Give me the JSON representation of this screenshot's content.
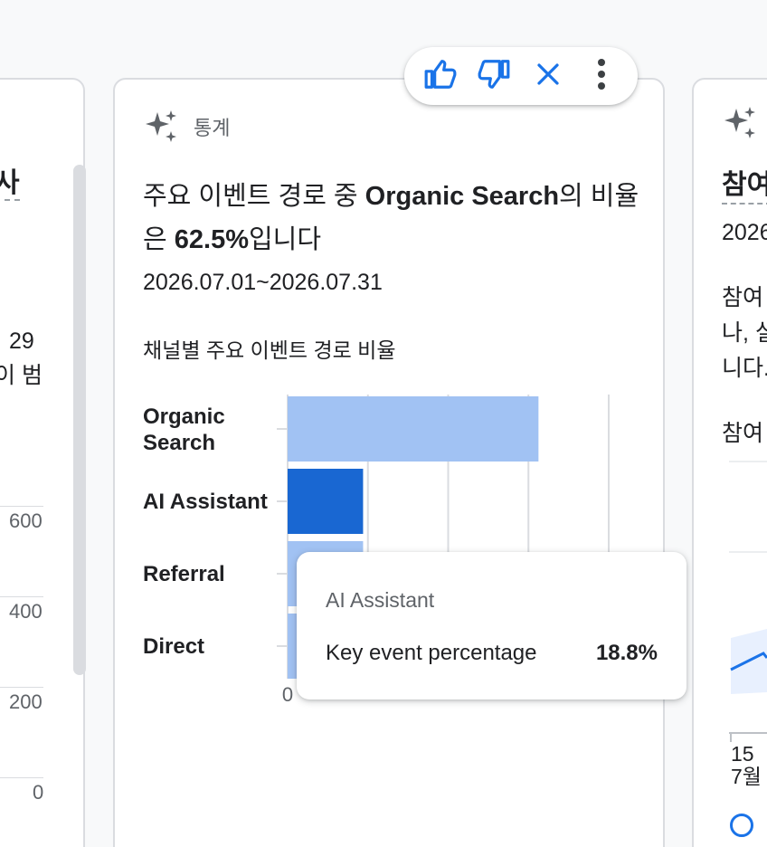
{
  "colors": {
    "accent": "#1a73e8",
    "bar_highlight": "#1967d2",
    "bar_light": "#a1c2f3",
    "grid": "#dadce0",
    "text_secondary": "#5f6368"
  },
  "left_card": {
    "title_fragment": "사",
    "line1_fragment": "29",
    "line2_fragment": "이 범",
    "y_ticks": [
      "600",
      "400",
      "200",
      "0"
    ]
  },
  "main_card": {
    "type_icon": "sparkle-icon",
    "type_label": "통계",
    "headline_prefix": "주요 이벤트 경로 중 ",
    "headline_bold1": "Organic Search",
    "headline_mid": "의 비율은 ",
    "headline_bold2": "62.5%",
    "headline_suffix": "입니다",
    "date_range": "2026.07.01~2026.07.31",
    "chart_title": "채널별 주요 이벤트 경로 비율"
  },
  "toolbar": {
    "thumbs_up_icon": "thumbs-up-icon",
    "thumbs_down_icon": "thumbs-down-icon",
    "close_icon": "close-icon",
    "more_icon": "more-vert-icon"
  },
  "chart_data": {
    "type": "bar",
    "orientation": "horizontal",
    "categories": [
      "Organic Search",
      "AI Assistant",
      "Referral",
      "Direct"
    ],
    "series": [
      {
        "name": "Key event percentage",
        "values": [
          0.625,
          0.188,
          0.188,
          0.188
        ]
      }
    ],
    "highlighted_category": "AI Assistant",
    "x_tick_labels": [
      "0"
    ],
    "xlim": [
      0,
      0.8
    ],
    "grid": true
  },
  "tooltip": {
    "title": "AI Assistant",
    "metric_label": "Key event percentage",
    "metric_value": "18.8%"
  },
  "right_card": {
    "title_fragment": "참여",
    "date_fragment": "2026",
    "body_line1": "참여",
    "body_line2": "나, 실",
    "body_line3": "니다.",
    "chart_title_fragment": "참여",
    "x_tick_day": "15",
    "x_tick_month": "7월"
  }
}
